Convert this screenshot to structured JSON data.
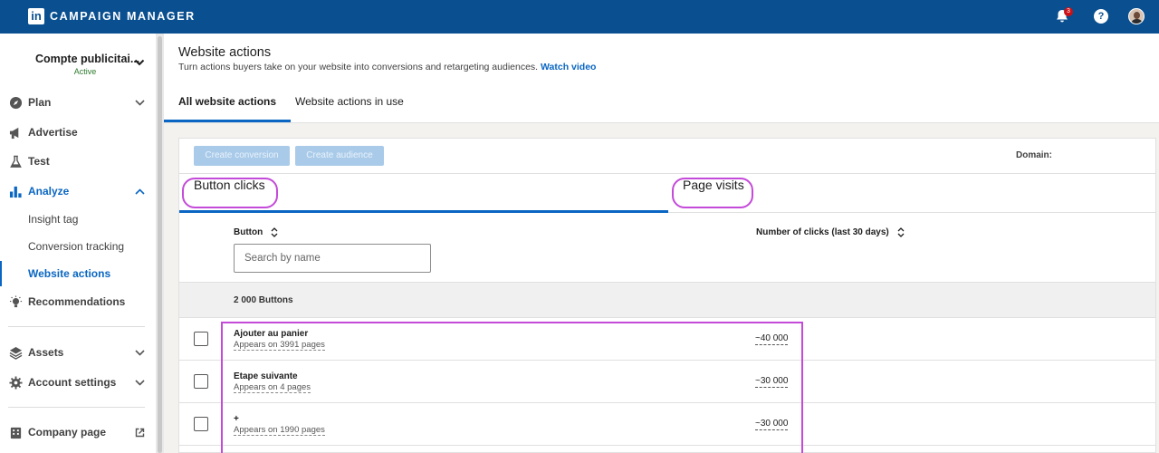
{
  "topbar": {
    "logo_text": "in",
    "brand": "CAMPAIGN MANAGER",
    "notification_count": "3",
    "help_icon": "?",
    "icons": [
      "bell-icon",
      "help-icon",
      "avatar"
    ]
  },
  "sidebar": {
    "account_name": "Compte publicitai...",
    "account_status": "Active",
    "items": [
      {
        "label": "Plan",
        "icon": "compass-icon",
        "expandable": true,
        "expanded": false
      },
      {
        "label": "Advertise",
        "icon": "megaphone-icon",
        "expandable": false
      },
      {
        "label": "Test",
        "icon": "flask-icon",
        "expandable": false
      },
      {
        "label": "Analyze",
        "icon": "bar-chart-icon",
        "expandable": true,
        "expanded": true,
        "active": true
      },
      {
        "label": "Insight tag",
        "sub": true
      },
      {
        "label": "Conversion tracking",
        "sub": true
      },
      {
        "label": "Website actions",
        "sub": true,
        "selected": true
      },
      {
        "label": "Recommendations",
        "icon": "lightbulb-icon",
        "expandable": false
      },
      {
        "label": "Assets",
        "icon": "stack-icon",
        "expandable": true,
        "expanded": false
      },
      {
        "label": "Account settings",
        "icon": "gear-icon",
        "expandable": true,
        "expanded": false
      },
      {
        "label": "Company page",
        "icon": "building-icon",
        "external": true
      }
    ]
  },
  "header": {
    "title": "Website actions",
    "subtitle": "Turn actions buyers take on your website into conversions and retargeting audiences.",
    "watch_video": "Watch video",
    "tabs": [
      {
        "label": "All website actions",
        "active": true
      },
      {
        "label": "Website actions in use",
        "active": false
      }
    ]
  },
  "toolbar": {
    "create_conversion": "Create conversion",
    "create_audience": "Create audience",
    "domain_label": "Domain:"
  },
  "subtabs": {
    "button_clicks": "Button clicks",
    "page_visits": "Page visits"
  },
  "table": {
    "col_button": "Button",
    "col_clicks": "Number of clicks (last 30 days)",
    "search_placeholder": "Search by name",
    "count": "2 000 Buttons",
    "rows": [
      {
        "name": "Ajouter au panier",
        "sub": "Appears on 3991 pages",
        "clicks": "~40 000"
      },
      {
        "name": "Etape suivante",
        "sub": "Appears on 4 pages",
        "clicks": "~30 000"
      },
      {
        "name": "+",
        "sub": "Appears on 1990 pages",
        "clicks": "~30 000"
      }
    ]
  },
  "colors": {
    "topbar": "#0a4f8f",
    "accent": "#0a66c2",
    "highlight": "#c44ad9"
  }
}
